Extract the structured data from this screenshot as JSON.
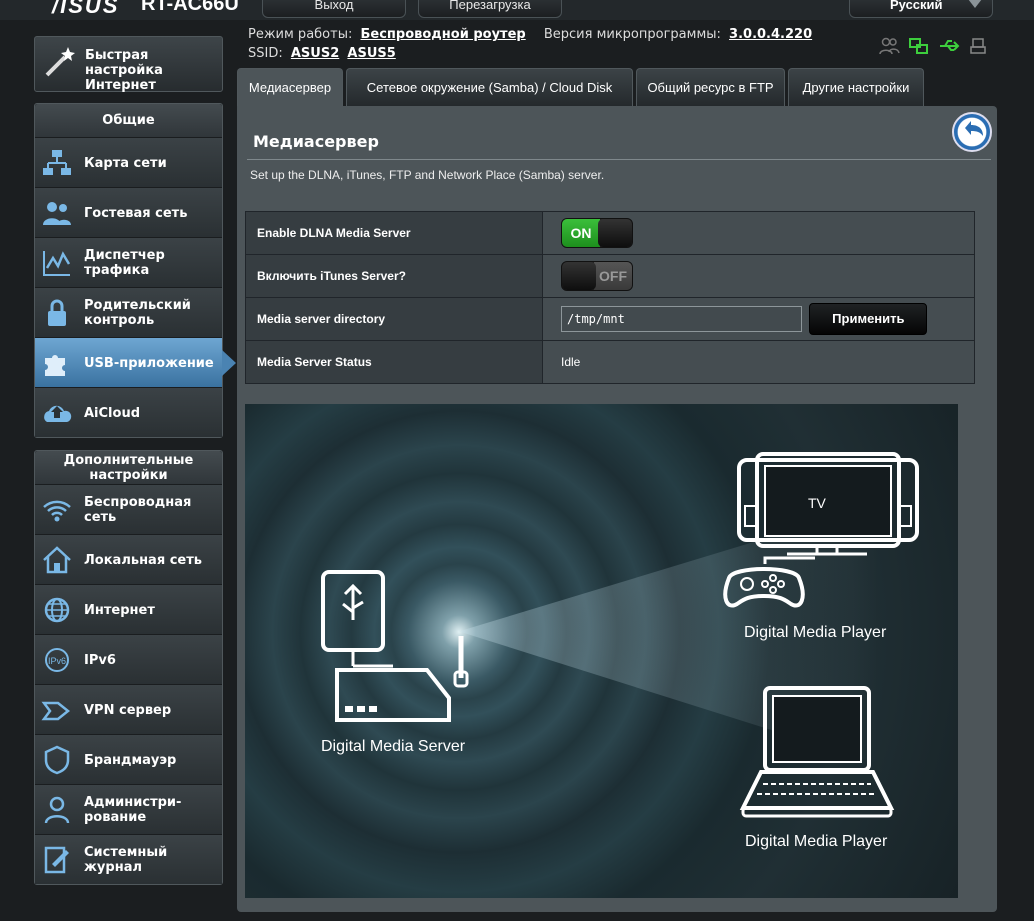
{
  "header": {
    "brand": "/ISUS",
    "model": "RT-AC66U",
    "logout": "Выход",
    "reboot": "Перезагрузка",
    "language": "Русский"
  },
  "info": {
    "mode_label": "Режим работы:",
    "mode_value": "Беспроводной роутер",
    "fw_label": "Версия микропрограммы:",
    "fw_value": "3.0.0.4.220",
    "ssid_label": "SSID:",
    "ssid1": "ASUS2",
    "ssid2": "ASUS5"
  },
  "status_icons": [
    "users-icon",
    "network-icon",
    "usb-icon",
    "printer-icon"
  ],
  "sidebar": {
    "quick_setup": "Быстрая настройка Интернет",
    "general_title": "Общие",
    "general": [
      {
        "label": "Карта сети",
        "icon": "network-map-icon"
      },
      {
        "label": "Гостевая сеть",
        "icon": "guest-network-icon"
      },
      {
        "label": "Диспетчер трафика",
        "icon": "traffic-icon"
      },
      {
        "label": "Родительский контроль",
        "icon": "lock-icon"
      },
      {
        "label": "USB-приложение",
        "icon": "puzzle-icon"
      },
      {
        "label": "AiCloud",
        "icon": "cloud-icon"
      }
    ],
    "advanced_title": "Дополнительные настройки",
    "advanced": [
      {
        "label": "Беспроводная сеть",
        "icon": "wifi-icon"
      },
      {
        "label": "Локальная сеть",
        "icon": "home-icon"
      },
      {
        "label": "Интернет",
        "icon": "globe-icon"
      },
      {
        "label": "IPv6",
        "icon": "ipv6-icon"
      },
      {
        "label": "VPN сервер",
        "icon": "vpn-icon"
      },
      {
        "label": "Брандмауэр",
        "icon": "shield-icon"
      },
      {
        "label": "Администри-рование",
        "icon": "admin-icon"
      },
      {
        "label": "Системный журнал",
        "icon": "log-icon"
      }
    ]
  },
  "tabs": [
    {
      "label": "Медиасервер"
    },
    {
      "label": "Сетевое окружение (Samba) / Cloud Disk"
    },
    {
      "label": "Общий ресурс в FTP"
    },
    {
      "label": "Другие настройки"
    }
  ],
  "panel": {
    "title": "Медиасервер",
    "description": "Set up the DLNA, iTunes, FTP and Network Place (Samba) server.",
    "rows": {
      "dlna_label": "Enable DLNA Media Server",
      "dlna_state": "ON",
      "itunes_label": "Включить iTunes Server?",
      "itunes_state": "OFF",
      "dir_label": "Media server directory",
      "dir_value": "/tmp/mnt",
      "apply": "Применить",
      "status_label": "Media Server Status",
      "status_value": "Idle"
    }
  },
  "illustration": {
    "server_caption": "Digital  Media Server",
    "player1_caption": "Digital  Media Player",
    "player2_caption": "Digital  Media Player",
    "tv_label": "TV"
  },
  "colors": {
    "accent": "#3a72a0",
    "toggle_on": "#2ea52e",
    "panel": "#4d5559"
  }
}
